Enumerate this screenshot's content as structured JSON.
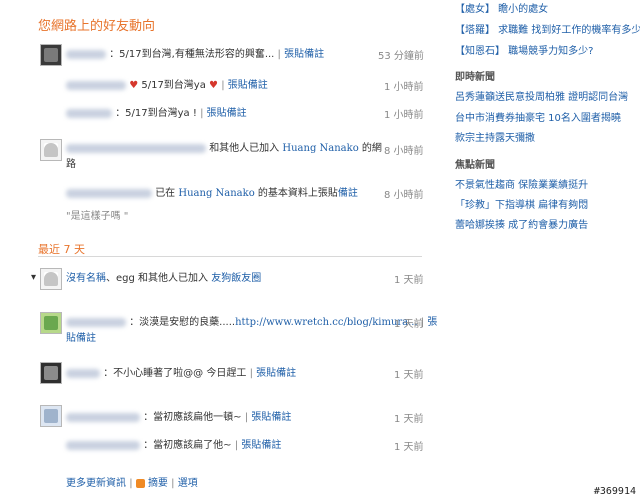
{
  "friends_section": {
    "title": "您網路上的好友動向",
    "items": [
      {
        "text": "：5/17到台灣,有種無法形容的興奮...",
        "action": "張貼備註",
        "time": "53 分鐘前"
      },
      {
        "text_a": "5/17到台灣ya",
        "action": "張貼備註",
        "time": "1 小時前"
      },
      {
        "text": "：5/17到台灣ya !",
        "action": "張貼備註",
        "time": "1 小時前"
      },
      {
        "text_a": "和其他人已加入",
        "name": "Huang Nanako",
        "text_b": "的網",
        "text_c": "路",
        "time": "8 小時前"
      },
      {
        "text_a": "已在",
        "name": "Huang Nanako",
        "text_b": "的基本資料上張貼",
        "action": "備註",
        "time": "8 小時前",
        "quote": "\"是這樣子嗎 \""
      }
    ]
  },
  "recent_section": {
    "title": "最近 7 天",
    "items": [
      {
        "text_a": "沒有名稱",
        "text_b": "、egg 和其他人已加入",
        "group": "友狗飯友圈",
        "time": "1 天前"
      },
      {
        "text": "：淡漠是安慰的良藥.....",
        "url": "http://www.wretch.cc/blog/kimura...",
        "action_a": "張",
        "action_b": "貼備註",
        "time": "1 天前"
      },
      {
        "text": "：不小心睡著了啦@@ 今日趕工",
        "action": "張貼備註",
        "time": "1 天前"
      },
      {
        "text": "：當初應該扁他一頓~",
        "action": "張貼備註",
        "time": "1 天前"
      },
      {
        "text": "：當初應該扁了他~",
        "action": "張貼備註",
        "time": "1 天前"
      }
    ]
  },
  "footer": {
    "more": "更多更新資訊",
    "rss": "摘要",
    "options": "選項"
  },
  "sidebar": {
    "top_links": [
      "【處女】 瞻小的處女",
      "【塔羅】 求職難 找到好工作的機率有多少?",
      "【知恩石】 職場競爭力知多少?"
    ],
    "news_title": "即時新聞",
    "news": [
      "呂秀蓮籲送民意投周柏雅 證明認同台灣",
      "台中市消費券抽豪宅 10名入圍者揭曉",
      "款宗主持露天彌撒"
    ],
    "hot_title": "焦點新聞",
    "hot": [
      "不景氣性趨商 保險業業績挺升",
      "「珍教」下指導棋 扁律有夠悶",
      "蕾哈娜挨揍 成了約會暴力廣告"
    ]
  },
  "watermark": "#369914",
  "colors": {
    "accent": "#e8742c",
    "link": "#1f5fa8"
  }
}
